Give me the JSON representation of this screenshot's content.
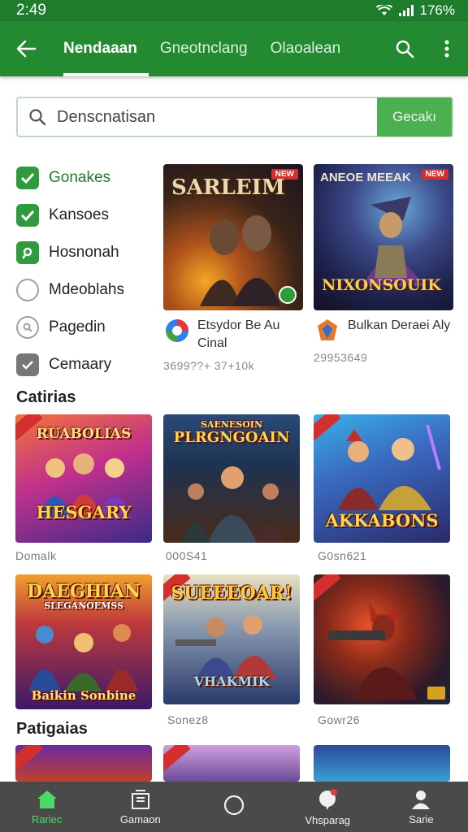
{
  "status": {
    "time": "2:49",
    "battery": "176%"
  },
  "appbar": {
    "tabs": [
      {
        "label": "Nendaaan"
      },
      {
        "label": "Gneotnclang"
      },
      {
        "label": "Olaoalean"
      }
    ]
  },
  "search": {
    "placeholder": "Denscnatisan",
    "button_label": "Gecakı"
  },
  "filters": [
    {
      "label": "Gonakes",
      "checked": true
    },
    {
      "label": "Kansoes",
      "checked": true
    },
    {
      "label": "Hosnonah",
      "checked": true
    },
    {
      "label": "Mdeoblahs",
      "checked": false
    },
    {
      "label": "Pagedin",
      "checked": false
    },
    {
      "label": "Cemaary",
      "checked": false
    }
  ],
  "featured": [
    {
      "art_title": "SARLEIM",
      "name": "Etsydor Be Au Cinal",
      "stats": "3699??+ 37+10k",
      "badge": "NEW"
    },
    {
      "art_title": "NIXONSOUIK",
      "header": "ANEOE MEEAK",
      "name": "Bulkan Deraei Aly",
      "stats": "29953649",
      "badge": "NEW"
    }
  ],
  "sections": {
    "categories_title": "Catirias",
    "popular_title": "Patigaias"
  },
  "tiles_row1": [
    {
      "art_title": "HESGARY",
      "caption": "Domalk"
    },
    {
      "art_title": "PLRGNGOAIN",
      "caption": "000S41"
    },
    {
      "art_title": "AKKABONS",
      "caption": "G0sn621"
    }
  ],
  "tiles_row2": [
    {
      "art_title": "DAEGHIAN",
      "caption": ""
    },
    {
      "art_title": "SUEEEOAR!",
      "caption": "Sonez8"
    },
    {
      "art_title": "",
      "caption": "Gowr26"
    }
  ],
  "bottom_nav": [
    {
      "label": "Rariec"
    },
    {
      "label": "Gamaon"
    },
    {
      "label": ""
    },
    {
      "label": "Vhsparag"
    },
    {
      "label": "Sarie"
    }
  ],
  "colors": {
    "brand": "#238a32",
    "accent": "#4caf50",
    "nav_bg": "#4a4a4a"
  }
}
